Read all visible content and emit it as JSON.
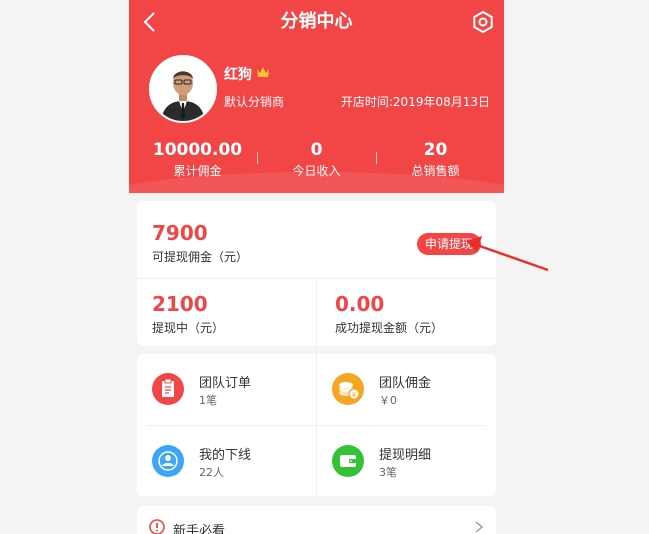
{
  "header": {
    "title": "分销中心",
    "back_icon": "chevron-left-icon",
    "settings_icon": "settings-icon",
    "bg_color": "#f24545"
  },
  "profile": {
    "name": "红狗",
    "level": "默认分销商",
    "open_date": "开店时间:2019年08月13日"
  },
  "stats": [
    {
      "value": "10000.00",
      "label": "累计佣金"
    },
    {
      "value": "0",
      "label": "今日收入"
    },
    {
      "value": "20",
      "label": "总销售额"
    }
  ],
  "withdraw": {
    "available_amount": "7900",
    "available_label": "可提现佣金（元）",
    "apply_label": "申请提现",
    "pending_amount": "2100",
    "pending_label": "提现中（元）",
    "success_amount": "0.00",
    "success_label": "成功提现金额（元）"
  },
  "menu": [
    {
      "title": "团队订单",
      "sub": "1笔",
      "icon": "clipboard-icon",
      "color": "#f24545"
    },
    {
      "title": "团队佣金",
      "sub": "￥0",
      "icon": "coins-icon",
      "color": "#f5a623"
    },
    {
      "title": "我的下线",
      "sub": "22人",
      "icon": "user-icon",
      "color": "#3aa6f5"
    },
    {
      "title": "提现明细",
      "sub": "3笔",
      "icon": "wallet-icon",
      "color": "#33c233"
    }
  ],
  "guide": {
    "label": "新手必看"
  }
}
